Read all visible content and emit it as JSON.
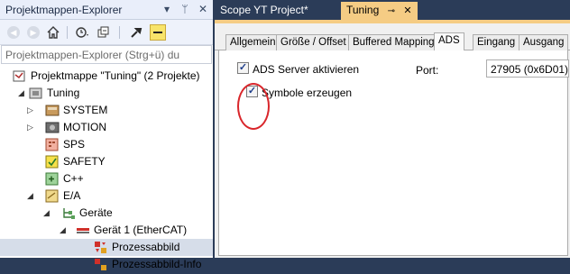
{
  "left_pane": {
    "title": "Projektmappen-Explorer",
    "title_controls": [
      "▾",
      "ᛘ",
      "✕"
    ],
    "toolbar_icons": [
      "back-icon",
      "forward-icon",
      "home-icon",
      "sync-icon",
      "collapse-icon",
      "properties-icon",
      "pin-toggle-icon"
    ],
    "search_placeholder": "Projektmappen-Explorer (Strg+ü) du",
    "tree": [
      {
        "label": "Projektmappe \"Tuning\" (2 Projekte)",
        "icon": "solution-icon",
        "expander": ""
      },
      {
        "label": "Tuning",
        "icon": "twincat-project-icon",
        "expander": "◢"
      },
      {
        "label": "SYSTEM",
        "icon": "system-icon",
        "expander": "▷"
      },
      {
        "label": "MOTION",
        "icon": "motion-icon",
        "expander": "▷"
      },
      {
        "label": "SPS",
        "icon": "plc-icon",
        "expander": ""
      },
      {
        "label": "SAFETY",
        "icon": "safety-icon",
        "expander": ""
      },
      {
        "label": "C++",
        "icon": "cpp-icon",
        "expander": ""
      },
      {
        "label": "E/A",
        "icon": "io-icon",
        "expander": "◢"
      },
      {
        "label": "Geräte",
        "icon": "devices-icon",
        "expander": "◢"
      },
      {
        "label": "Gerät 1 (EtherCAT)",
        "icon": "ethercat-icon",
        "expander": "◢"
      },
      {
        "label": "Prozessabbild",
        "icon": "process-image-icon",
        "expander": "",
        "selected": true
      },
      {
        "label": "Prozessabbild-Info",
        "icon": "process-image-icon",
        "expander": ""
      }
    ]
  },
  "doc_tabs": [
    {
      "label": "Scope YT Project*",
      "active": false
    },
    {
      "label": "Tuning",
      "active": true,
      "pin": "⊸",
      "close": "✕"
    }
  ],
  "prop_tabs": [
    "Allgemein",
    "Größe / Offset",
    "Buffered Mapping",
    "ADS",
    "Eingang",
    "Ausgang"
  ],
  "active_prop_tab": "ADS",
  "ads": {
    "server_label": "ADS Server aktivieren",
    "server_checked": true,
    "symbols_label": "Symbole erzeugen",
    "symbols_checked": true,
    "port_label": "Port:",
    "port_value": "27905 (0x6D01)"
  },
  "colors": {
    "accent_tab": "#f5cc84",
    "frame": "#2b3c58",
    "highlight_circle": "#d9262b"
  }
}
